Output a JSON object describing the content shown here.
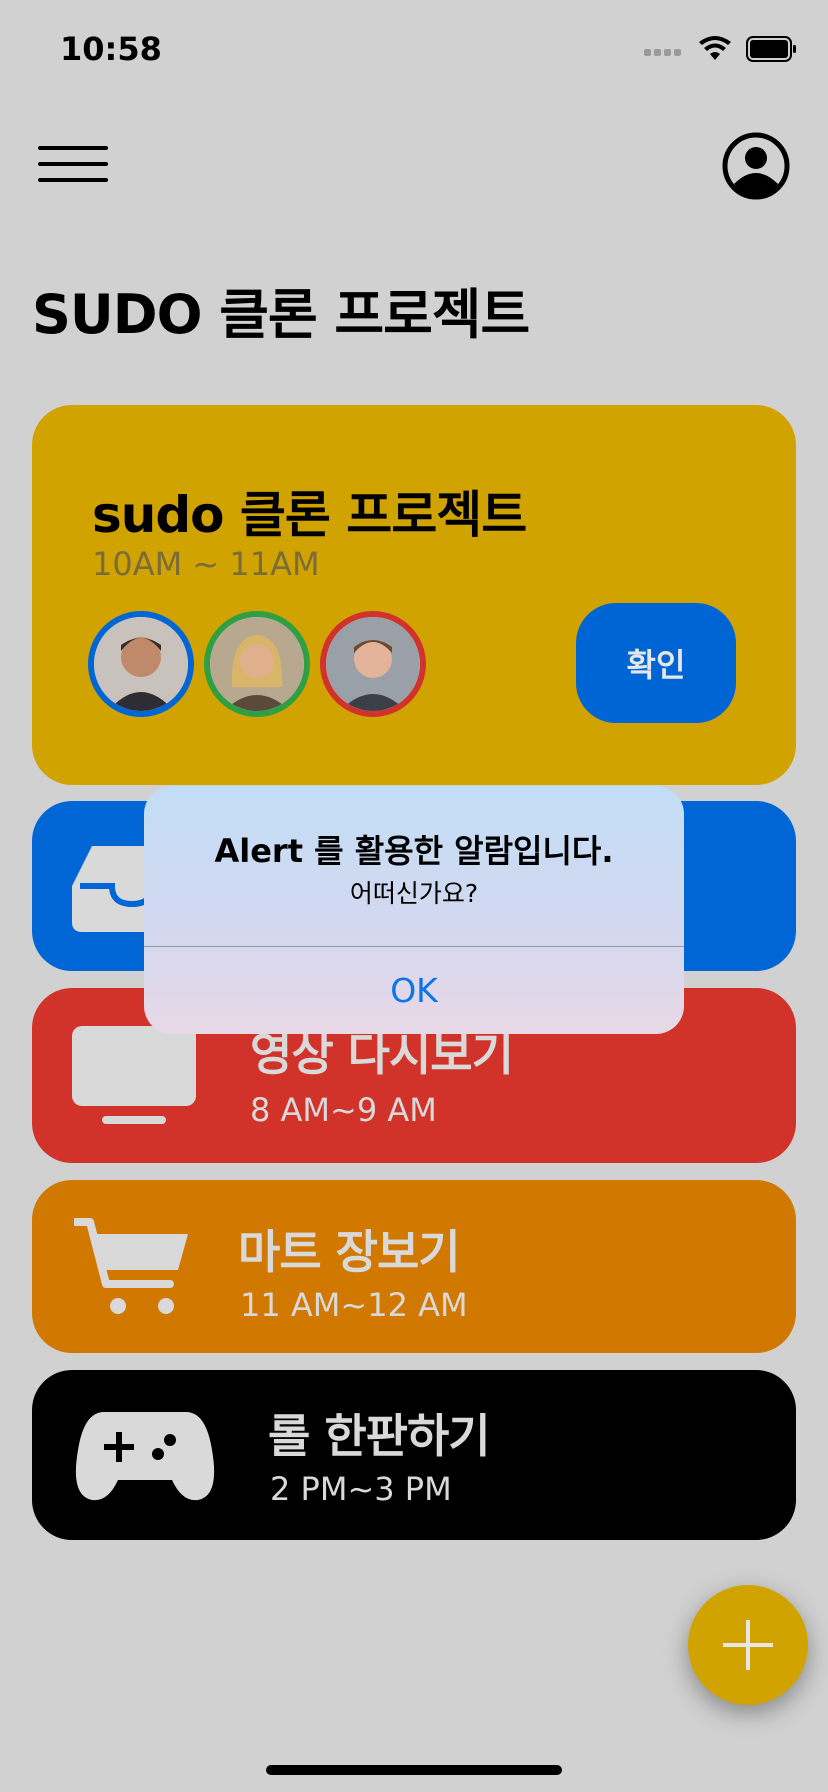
{
  "status_bar": {
    "time": "10:58"
  },
  "header": {
    "page_title": "SUDO 클론 프로젝트"
  },
  "main_card": {
    "title": "sudo 클론 프로젝트",
    "time": "10AM ~ 11AM",
    "confirm_label": "확인",
    "avatar_colors": [
      "#0066d6",
      "#2ea043",
      "#d13229"
    ],
    "background": "#d1a300"
  },
  "cards": [
    {
      "icon": "tray-icon",
      "title": "",
      "time": "",
      "color": "#0066d6"
    },
    {
      "icon": "tv-icon",
      "title": "영상 다시보기",
      "time": "8 AM~9 AM",
      "color": "#d13229"
    },
    {
      "icon": "cart-icon",
      "title": "마트 장보기",
      "time": "11 AM~12 AM",
      "color": "#d07800"
    },
    {
      "icon": "gamecontroller-icon",
      "title": "롤 한판하기",
      "time": "2 PM~3 PM",
      "color": "#000000"
    }
  ],
  "alert": {
    "title": "Alert 를 활용한 알람입니다.",
    "message": "어떠신가요?",
    "ok_label": "OK"
  },
  "fab": {
    "icon": "plus-icon",
    "color": "#d1a300"
  }
}
